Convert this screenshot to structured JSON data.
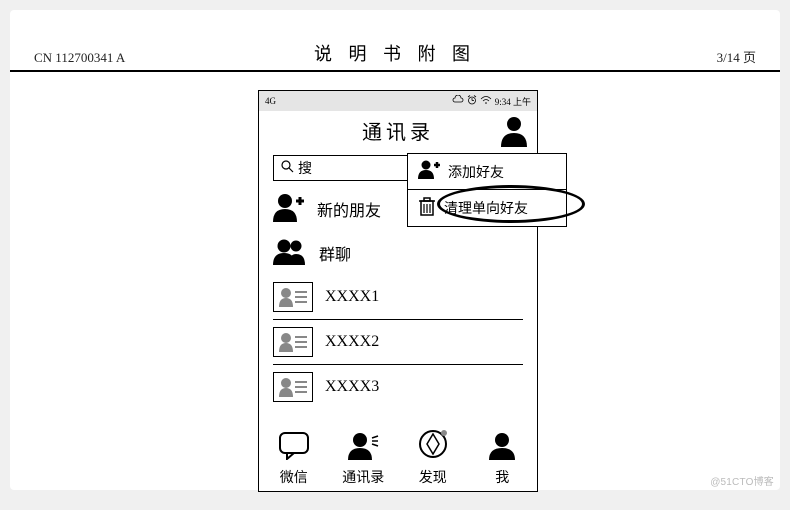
{
  "doc": {
    "id": "CN 112700341 A",
    "title": "说 明 书 附 图",
    "page": "3/14 页"
  },
  "status": {
    "signal": "4G",
    "time": "9:34 上午"
  },
  "header": {
    "title": "通讯录"
  },
  "search": {
    "placeholder": "搜"
  },
  "popup": {
    "add": "添加好友",
    "clean": "清理单向好友"
  },
  "rows": {
    "new_friends": "新的朋友",
    "group_chat": "群聊",
    "contacts": [
      "XXXX1",
      "XXXX2",
      "XXXX3"
    ]
  },
  "tabs": {
    "wechat": "微信",
    "contacts": "通讯录",
    "discover": "发现",
    "me": "我"
  },
  "watermark": "@51CTO博客"
}
